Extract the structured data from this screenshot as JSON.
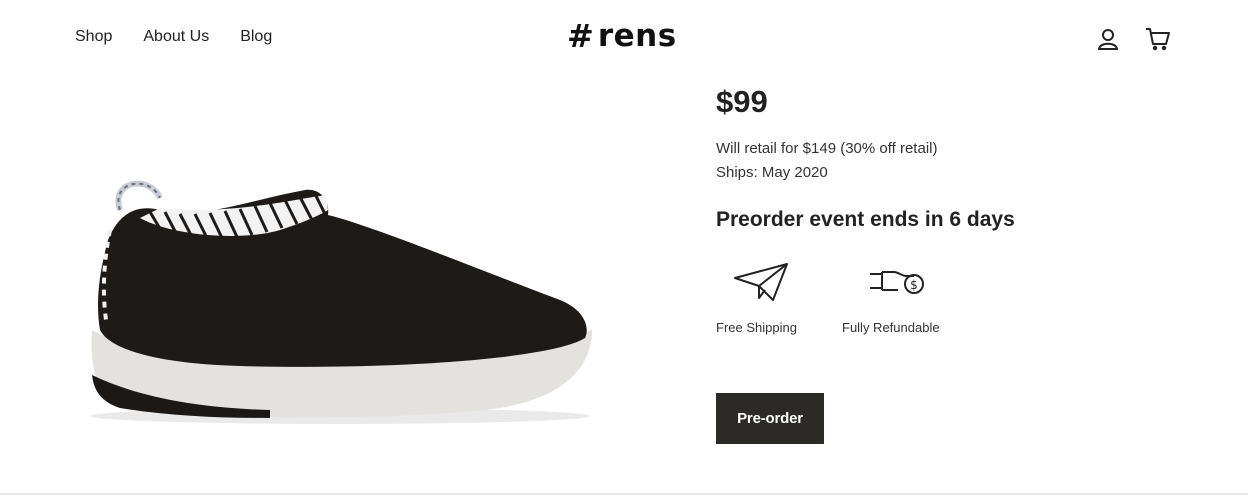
{
  "nav": {
    "items": [
      {
        "label": "Shop"
      },
      {
        "label": "About Us"
      },
      {
        "label": "Blog"
      }
    ]
  },
  "logo": {
    "symbol": "#",
    "text": "rens"
  },
  "icons": {
    "account": "user-icon",
    "cart": "cart-icon",
    "shipping": "paper-plane-icon",
    "refund": "hand-money-icon"
  },
  "product": {
    "image_alt": "black sneaker with white sole",
    "price": "$99",
    "retail": "Will retail for $149 (30% off retail)",
    "ships": "Ships: May 2020",
    "event": "Preorder event ends in 6 days",
    "features": [
      {
        "label": "Free Shipping"
      },
      {
        "label": "Fully Refundable"
      }
    ],
    "button_label": "Pre-order"
  },
  "colors": {
    "button_bg": "#2b2a27",
    "text": "#222222",
    "shoe_upper": "#1e1a18",
    "sole": "#e4e2de"
  }
}
